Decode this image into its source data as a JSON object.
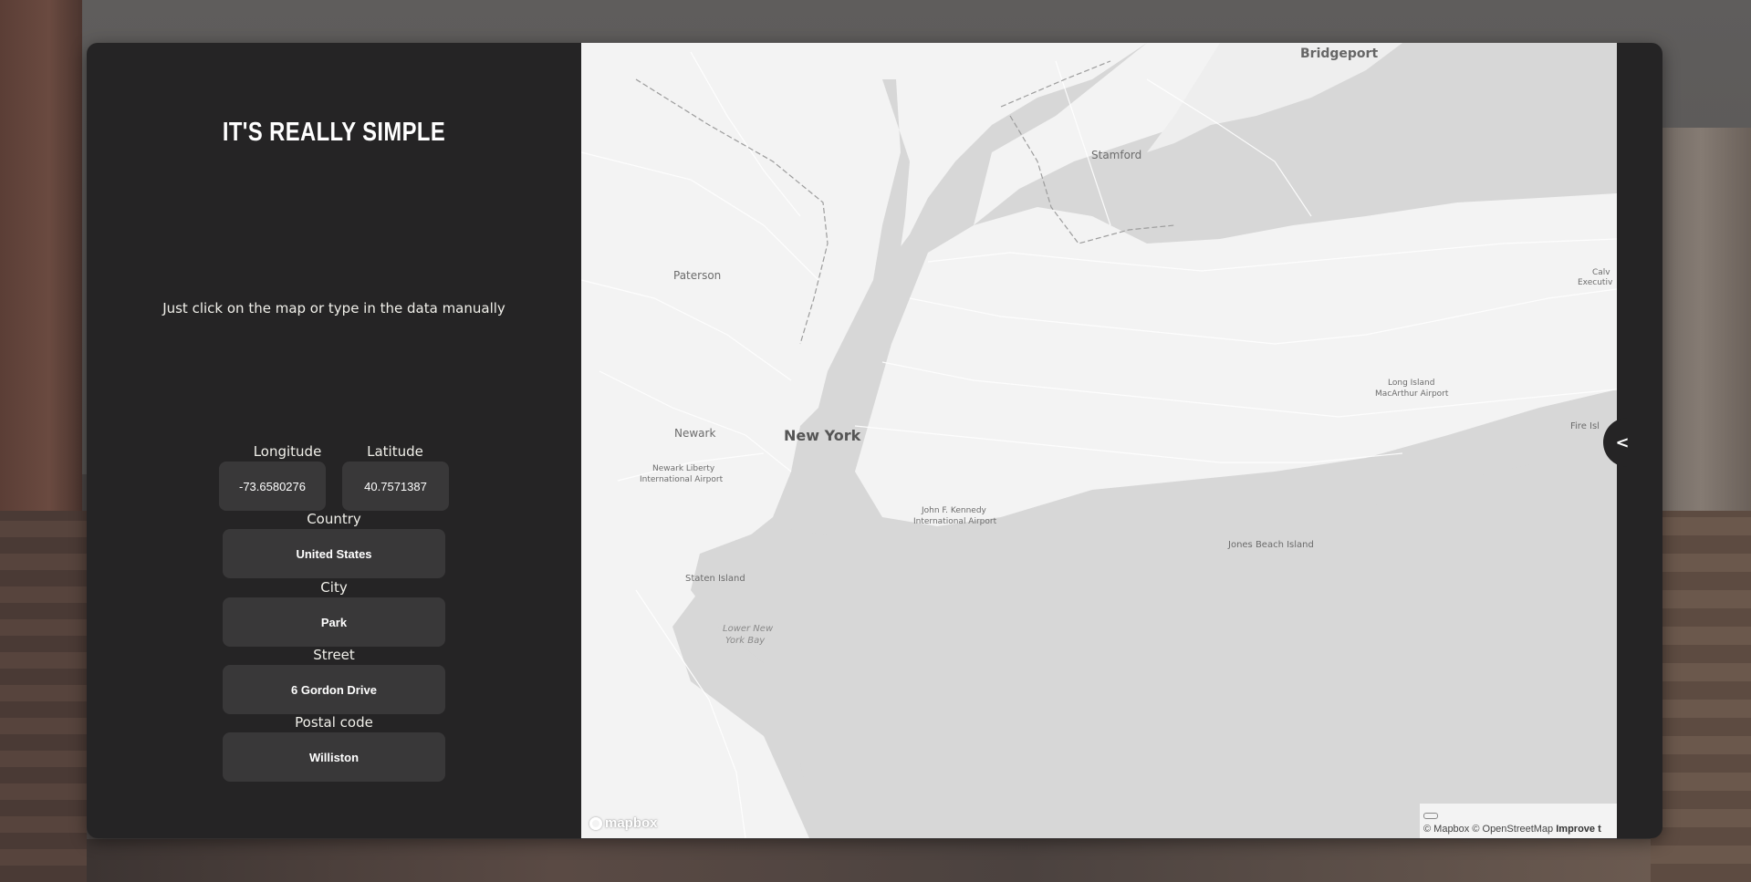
{
  "panel": {
    "title": "IT'S REALLY SIMPLE",
    "subtitle": "Just click on the map or type in the data manually"
  },
  "form": {
    "longitude_label": "Longitude",
    "longitude_value": "-73.6580276",
    "latitude_label": "Latitude",
    "latitude_value": "40.7571387",
    "country_label": "Country",
    "country_value": "United States",
    "city_label": "City",
    "city_value": "Park",
    "street_label": "Street",
    "street_value": "6 Gordon Drive",
    "postal_label": "Postal code",
    "postal_value": "Williston"
  },
  "map": {
    "places": {
      "bridgeport": "Bridgeport",
      "stamford": "Stamford",
      "paterson": "Paterson",
      "newark": "Newark",
      "newyork": "New York",
      "newark_airport_1": "Newark Liberty",
      "newark_airport_2": "International Airport",
      "jfk_1": "John F. Kennedy",
      "jfk_2": "International Airport",
      "staten": "Staten Island",
      "bay_1": "Lower New",
      "bay_2": "York Bay",
      "jones": "Jones Beach Island",
      "li_airport_1": "Long Island",
      "li_airport_2": "MacArthur Airport",
      "fire": "Fire Isl",
      "calv_1": "Calv",
      "calv_2": "Executiv"
    },
    "logo": "mapbox",
    "attribution": "© Mapbox © OpenStreetMap",
    "improve": "Improve t"
  },
  "toggle_tab": {
    "icon_glyph": "<"
  }
}
